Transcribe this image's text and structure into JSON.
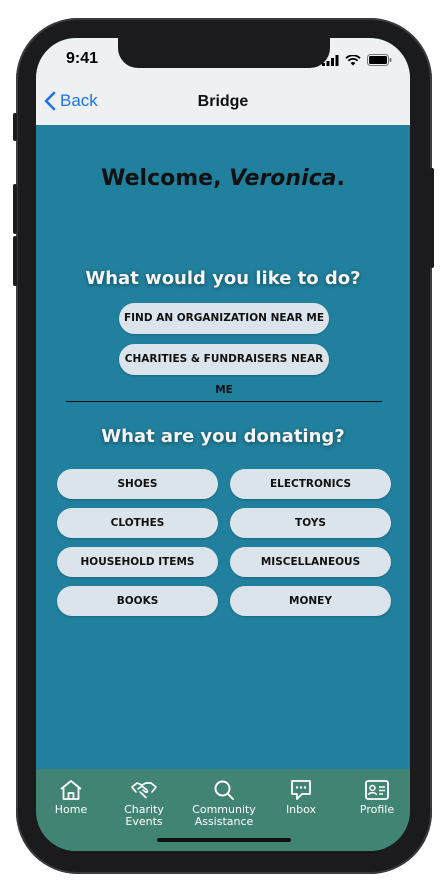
{
  "status": {
    "time": "9:41"
  },
  "nav": {
    "back_label": "Back",
    "title": "Bridge"
  },
  "welcome": {
    "prefix": "Welcome, ",
    "name": "Veronica",
    "suffix": "."
  },
  "actions": {
    "heading": "What would you like to do?",
    "find_org": "FIND AN ORGANIZATION NEAR ME",
    "charities": "CHARITIES & FUNDRAISERS NEAR ME"
  },
  "donating": {
    "heading": "What are you donating?",
    "items": [
      "SHOES",
      "ELECTRONICS",
      "CLOTHES",
      "TOYS",
      "HOUSEHOLD ITEMS",
      "MISCELLANEOUS",
      "BOOKS",
      "MONEY"
    ]
  },
  "tabs": [
    {
      "label": "Home",
      "icon": "home-icon"
    },
    {
      "label": "Charity Events",
      "icon": "handshake-icon"
    },
    {
      "label": "Community Assistance",
      "icon": "search-icon"
    },
    {
      "label": "Inbox",
      "icon": "message-icon"
    },
    {
      "label": "Profile",
      "icon": "profile-card-icon"
    }
  ],
  "colors": {
    "background": "#21809e",
    "tabbar": "#418474",
    "pill": "#dbe4ea",
    "link": "#1a73e8"
  }
}
